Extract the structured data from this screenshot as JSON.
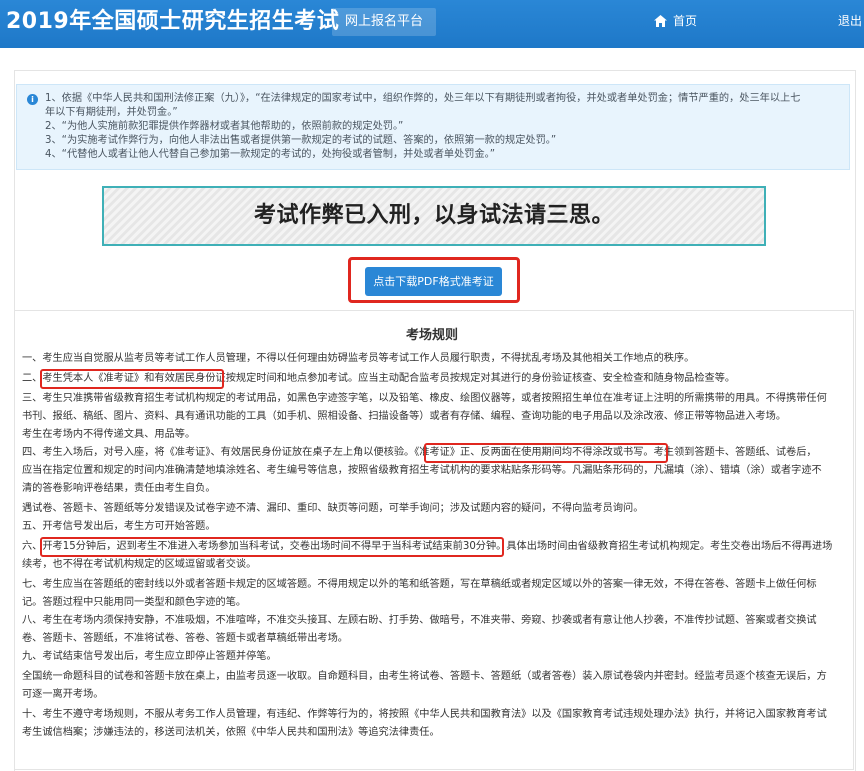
{
  "header": {
    "title": "2019年全国硕士研究生招生考试",
    "platform_tab": "网上报名平台",
    "home": "首页",
    "exit": "退出"
  },
  "notice": {
    "lines": [
      "1、依据《中华人民共和国刑法修正案（九）》，“在法律规定的国家考试中，组织作弊的，处三年以下有期徒刑或者拘役，并处或者单处罚金；情节严重的，处三年以上七",
      "年以下有期徒刑，并处罚金。”",
      "2、“为他人实施前款犯罪提供作弊器材或者其他帮助的，依照前款的规定处罚。”",
      "3、“为实施考试作弊行为，向他人非法出售或者提供第一款规定的考试的试题、答案的，依照第一款的规定处罚。”",
      "4、“代替他人或者让他人代替自己参加第一款规定的考试的，处拘役或者管制，并处或者单处罚金。”"
    ]
  },
  "slogan": "考试作弊已入刑，以身试法请三思。",
  "download_button": "点击下载PDF格式准考证",
  "rules": {
    "title": "考场规则",
    "lines": [
      "一、考生应当自觉服从监考员等考试工作人员管理，不得以任何理由妨碍监考员等考试工作人员履行职责，不得扰乱考场及其他相关工作地点的秩序。",
      "二、考生凭本人《准考证》和有效居民身份证按规定时间和地点参加考试。应当主动配合监考员按规定对其进行的身份验证核查、安全检查和随身物品检查等。",
      "三、考生只准携带省级教育招生考试机构规定的考试用品，如黑色字迹签字笔，以及铅笔、橡皮、绘图仪器等，或者按照招生单位在准考证上注明的所需携带的用具。不得携带任何",
      "书刊、报纸、稿纸、图片、资料、具有通讯功能的工具（如手机、照相设备、扫描设备等）或者有存储、编程、查询功能的电子用品以及涂改液、修正带等物品进入考场。",
      "考生在考场内不得传递文具、用品等。",
      "四、考生入场后，对号入座，将《准考证》、有效居民身份证放在桌子左上角以便核验。《准考证》正、反两面在使用期间均不得涂改或书写。考生领到答题卡、答题纸、试卷后，",
      "应当在指定位置和规定的时间内准确清楚地填涂姓名、考生编号等信息，按照省级教育招生考试机构的要求粘贴条形码等。凡漏贴条形码的，凡漏填（涂）、错填（涂）或者字迹不",
      "清的答卷影响评卷结果，责任由考生自负。",
      "遇试卷、答题卡、答题纸等分发错误及试卷字迹不清、漏印、重印、缺页等问题，可举手询问；涉及试题内容的疑问，不得向监考员询问。",
      "五、开考信号发出后，考生方可开始答题。",
      "六、开考15分钟后，迟到考生不准进入考场参加当科考试，交卷出场时间不得早于当科考试结束前30分钟。具体出场时间由省级教育招生考试机构规定。考生交卷出场后不得再进场",
      "续考，也不得在考试机构规定的区域逗留或者交谈。",
      "七、考生应当在答题纸的密封线以外或者答题卡规定的区域答题。不得用规定以外的笔和纸答题，写在草稿纸或者规定区域以外的答案一律无效，不得在答卷、答题卡上做任何标",
      "记。答题过程中只能用同一类型和颜色字迹的笔。",
      "八、考生在考场内须保持安静，不准吸烟，不准喧哗，不准交头接耳、左顾右盼、打手势、做暗号，不准夹带、旁窥、抄袭或者有意让他人抄袭，不准传抄试题、答案或者交换试",
      "卷、答题卡、答题纸，不准将试卷、答卷、答题卡或者草稿纸带出考场。",
      "九、考试结束信号发出后，考生应立即停止答题并停笔。",
      "全国统一命题科目的试卷和答题卡放在桌上，由监考员逐一收取。自命题科目，由考生将试卷、答题卡、答题纸（或者答卷）装入原试卷袋内并密封。经监考员逐个核查无误后，方",
      "可逐一离开考场。",
      "十、考生不遵守考场规则，不服从考务工作人员管理，有违纪、作弊等行为的，将按照《中华人民共和国教育法》以及《国家教育考试违规处理办法》执行，并将记入国家教育考试",
      "考生诚信档案；涉嫌违法的，移送司法机关，依照《中华人民共和国刑法》等追究法律责任。"
    ]
  },
  "colors": {
    "header": "#1e78c8",
    "accent": "#2a87d6",
    "highlight": "#e0271f",
    "slogan_border": "#3fb0b7"
  },
  "icons": {
    "home": "home-icon",
    "notice": "info-icon"
  }
}
